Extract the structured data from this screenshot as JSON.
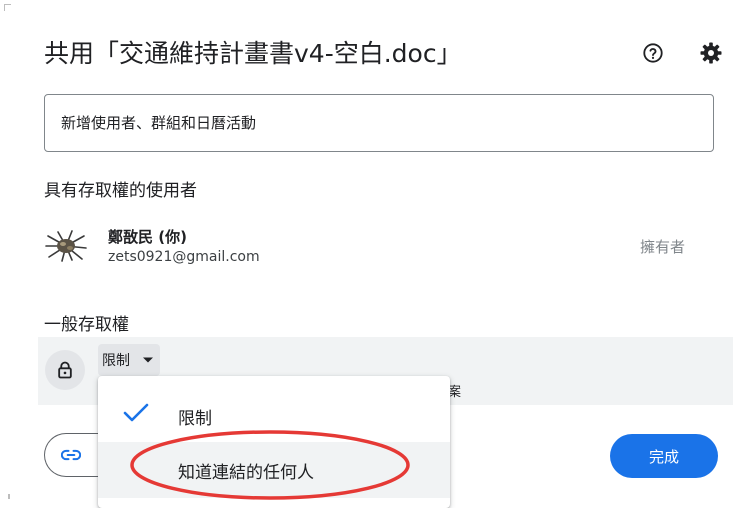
{
  "dialog": {
    "title": "共用「交通維持計畫書v4-空白.doc」",
    "help_icon": "help-circle-icon",
    "settings_icon": "gear-icon"
  },
  "share_input": {
    "placeholder": "新增使用者、群組和日曆活動",
    "value": ""
  },
  "people_with_access": {
    "heading": "具有存取權的使用者",
    "users": [
      {
        "name": "鄭敔民 (你)",
        "email": "zets0921@gmail.com",
        "role": "擁有者",
        "avatar_icon": "avatar-photo"
      }
    ]
  },
  "general_access": {
    "heading": "一般存取權",
    "icon": "lock-icon",
    "selected": "限制",
    "description_partial": "案"
  },
  "access_menu": {
    "options": [
      {
        "label": "限制",
        "selected": true
      },
      {
        "label": "知道連結的任何人",
        "selected": false,
        "highlighted": true
      }
    ]
  },
  "footer": {
    "copy_link_icon": "link-icon",
    "done_label": "完成"
  },
  "colors": {
    "primary": "#1a73e8",
    "annotation_red": "#e53935",
    "band_gray": "#f1f3f4"
  }
}
